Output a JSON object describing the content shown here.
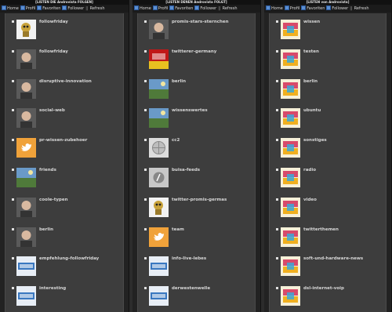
{
  "columns": [
    {
      "title": "[LISTEN DIE Androvista FOLGEN]",
      "nav": {
        "home": "Home",
        "profil": "Profil",
        "favoriten": "Favoriten",
        "follower": "Follower",
        "separator": "||",
        "refresh": "Refresh"
      },
      "items": [
        {
          "label": "followfriday",
          "icon": "robot-avatar"
        },
        {
          "label": "followfriday",
          "icon": "face-avatar"
        },
        {
          "label": "disruptive-innovation",
          "icon": "face-avatar"
        },
        {
          "label": "social-web",
          "icon": "face-avatar"
        },
        {
          "label": "pr-wissen-zubehoer",
          "icon": "twitter-bird-avatar"
        },
        {
          "label": "friends",
          "icon": "landscape-avatar"
        },
        {
          "label": "coole-typen",
          "icon": "face-avatar"
        },
        {
          "label": "berlin",
          "icon": "face-avatar"
        },
        {
          "label": "empfehlung-followfriday",
          "icon": "logo-avatar"
        },
        {
          "label": "interesting",
          "icon": "logo-avatar"
        }
      ]
    },
    {
      "title": "[LISTEN DENEN Androvista FOLGT]",
      "nav": {
        "home": "Home",
        "profil": "Profil",
        "favoriten": "Favoriten",
        "follower": "Follower",
        "separator": "||",
        "refresh": "Refresh"
      },
      "items": [
        {
          "label": "promis-stars-sternchen",
          "icon": "face-avatar"
        },
        {
          "label": "twitterer-germany",
          "icon": "flag-avatar"
        },
        {
          "label": "berlin",
          "icon": "landscape-avatar"
        },
        {
          "label": "wissenswertes",
          "icon": "landscape-avatar"
        },
        {
          "label": "cc2",
          "icon": "globe-avatar"
        },
        {
          "label": "buisa-feeds",
          "icon": "generic-avatar"
        },
        {
          "label": "twitter-promis-germas",
          "icon": "robot-avatar"
        },
        {
          "label": "team",
          "icon": "twitter-bird-avatar"
        },
        {
          "label": "info-live-lebes",
          "icon": "logo-avatar"
        },
        {
          "label": "derwestenwelle",
          "icon": "logo-avatar"
        }
      ]
    },
    {
      "title": "[LISTEN von Androvista]",
      "nav": {
        "home": "Home",
        "profil": "Profil",
        "favoriten": "Favoriten",
        "follower": "Follower",
        "separator": "||",
        "refresh": "Refresh"
      },
      "items": [
        {
          "label": "wissen",
          "icon": "vista-logo-avatar"
        },
        {
          "label": "testen",
          "icon": "vista-logo-avatar"
        },
        {
          "label": "berlin",
          "icon": "vista-logo-avatar"
        },
        {
          "label": "ubuntu",
          "icon": "vista-logo-avatar"
        },
        {
          "label": "sonstiges",
          "icon": "vista-logo-avatar"
        },
        {
          "label": "radio",
          "icon": "vista-logo-avatar"
        },
        {
          "label": "video",
          "icon": "vista-logo-avatar"
        },
        {
          "label": "twitterthemen",
          "icon": "vista-logo-avatar"
        },
        {
          "label": "soft-und-hardware-news",
          "icon": "vista-logo-avatar"
        },
        {
          "label": "dsl-internet-voip",
          "icon": "vista-logo-avatar"
        }
      ]
    }
  ],
  "colors": {
    "page_bg": "#2c2c2c",
    "panel_bg": "#3d3d3d",
    "label": "#d6d6d6",
    "nav_icon": "#5c8fd0"
  }
}
